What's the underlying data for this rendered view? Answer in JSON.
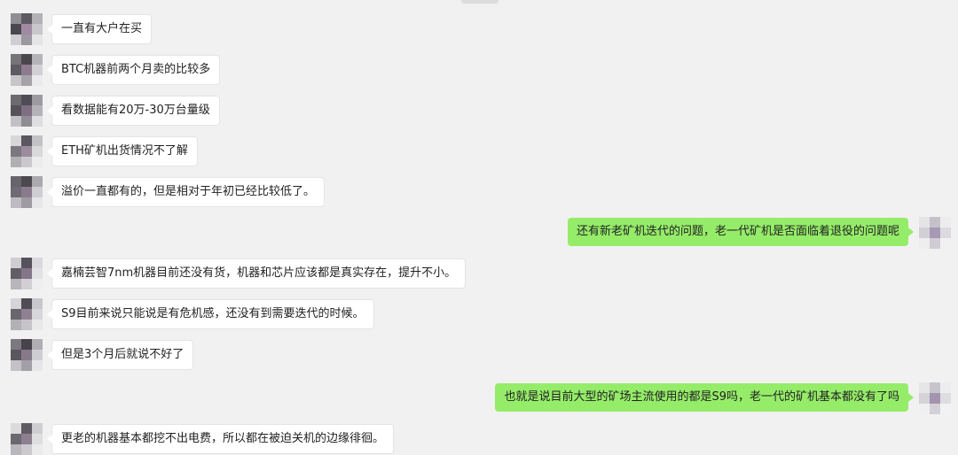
{
  "chat": {
    "messages": [
      {
        "from": "other",
        "text": "一直有大户在买"
      },
      {
        "from": "other",
        "text": "BTC机器前两个月卖的比较多"
      },
      {
        "from": "other",
        "text": "看数据能有20万-30万台量级"
      },
      {
        "from": "other",
        "text": "ETH矿机出货情况不了解"
      },
      {
        "from": "other",
        "text": "溢价一直都有的，但是相对于年初已经比较低了。"
      },
      {
        "from": "me",
        "text": "还有新老矿机迭代的问题，老一代矿机是否面临着退役的问题呢"
      },
      {
        "from": "other",
        "text": "嘉楠芸智7nm机器目前还没有货，机器和芯片应该都是真实存在，提升不小。"
      },
      {
        "from": "other",
        "text": "S9目前来说只能说是有危机感，还没有到需要迭代的时候。"
      },
      {
        "from": "other",
        "text": "但是3个月后就说不好了"
      },
      {
        "from": "me",
        "text": "也就是说目前大型的矿场主流使用的都是S9吗，老一代的矿机基本都没有了吗"
      },
      {
        "from": "other",
        "text": "更老的机器基本都挖不出电费，所以都在被迫关机的边缘徘徊。"
      }
    ]
  },
  "colors": {
    "background": "#f1f1f1",
    "incoming_bubble": "#ffffff",
    "outgoing_bubble": "#95ec69"
  }
}
